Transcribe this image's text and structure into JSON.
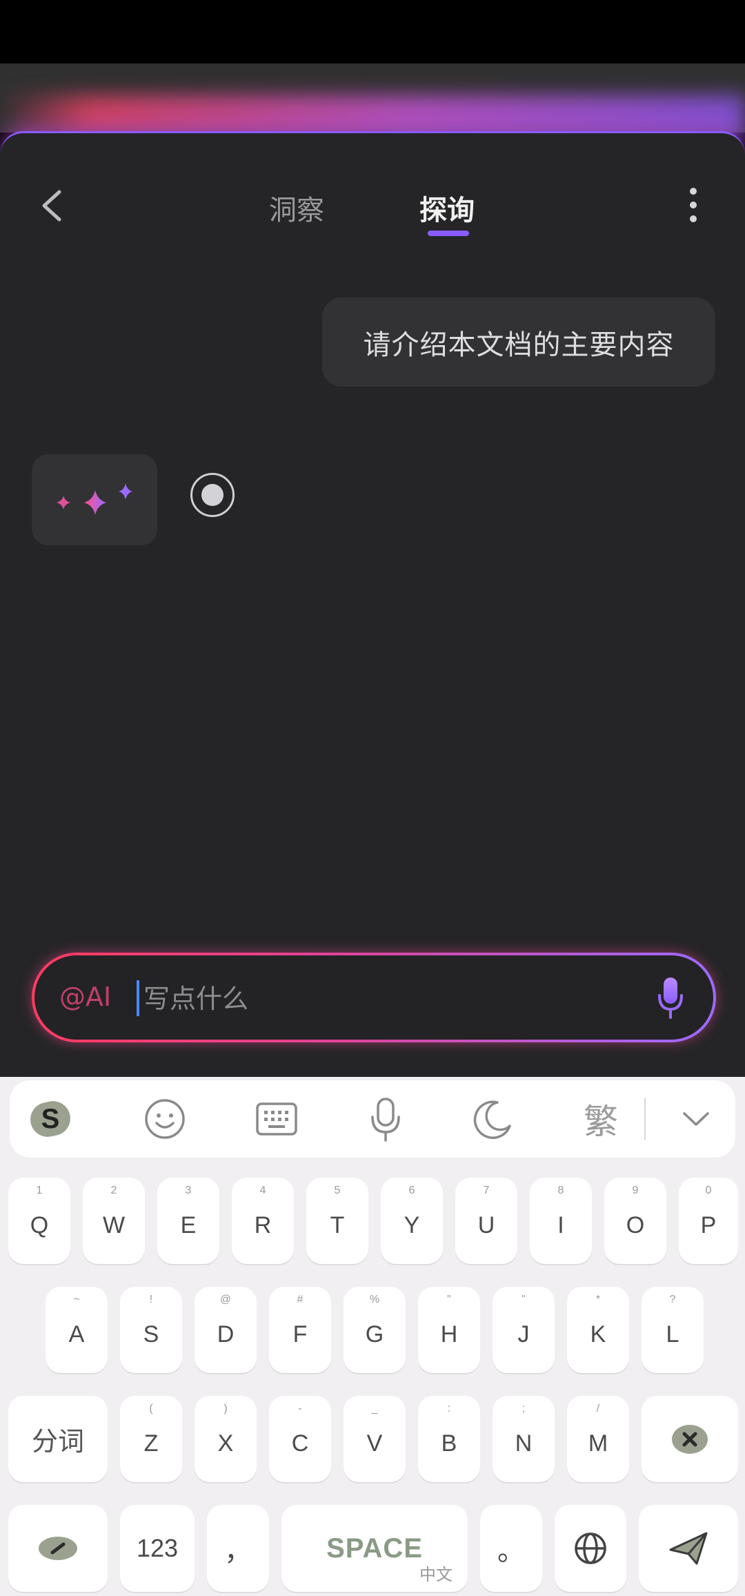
{
  "header": {
    "tabs": [
      {
        "label": "洞察",
        "active": false
      },
      {
        "label": "探询",
        "active": true
      }
    ]
  },
  "chat": {
    "user_message": "请介绍本文档的主要内容"
  },
  "composer": {
    "mention": "@AI",
    "placeholder": "写点什么",
    "value": ""
  },
  "keyboard": {
    "toolbar": {
      "traditional_label": "繁"
    },
    "row1": [
      {
        "hint": "1",
        "cap": "Q"
      },
      {
        "hint": "2",
        "cap": "W"
      },
      {
        "hint": "3",
        "cap": "E"
      },
      {
        "hint": "4",
        "cap": "R"
      },
      {
        "hint": "5",
        "cap": "T"
      },
      {
        "hint": "6",
        "cap": "Y"
      },
      {
        "hint": "7",
        "cap": "U"
      },
      {
        "hint": "8",
        "cap": "I"
      },
      {
        "hint": "9",
        "cap": "O"
      },
      {
        "hint": "0",
        "cap": "P"
      }
    ],
    "row2": [
      {
        "hint": "~",
        "cap": "A"
      },
      {
        "hint": "!",
        "cap": "S"
      },
      {
        "hint": "@",
        "cap": "D"
      },
      {
        "hint": "#",
        "cap": "F"
      },
      {
        "hint": "%",
        "cap": "G"
      },
      {
        "hint": "\"",
        "cap": "H"
      },
      {
        "hint": "\"",
        "cap": "J"
      },
      {
        "hint": "*",
        "cap": "K"
      },
      {
        "hint": "?",
        "cap": "L"
      }
    ],
    "row3": [
      {
        "hint": "(",
        "cap": "Z"
      },
      {
        "hint": ")",
        "cap": "X"
      },
      {
        "hint": "-",
        "cap": "C"
      },
      {
        "hint": "_",
        "cap": "V"
      },
      {
        "hint": ":",
        "cap": "B"
      },
      {
        "hint": ";",
        "cap": "N"
      },
      {
        "hint": "/",
        "cap": "M"
      }
    ],
    "segment_label": "分词",
    "numbers_label": "123",
    "comma_label": "，",
    "space_label": "SPACE",
    "space_sub": "中文",
    "period_label": "。"
  },
  "colors": {
    "accent": "#8a5cff",
    "glow_start": "#ff3b5f",
    "glow_end": "#9b6bff"
  }
}
